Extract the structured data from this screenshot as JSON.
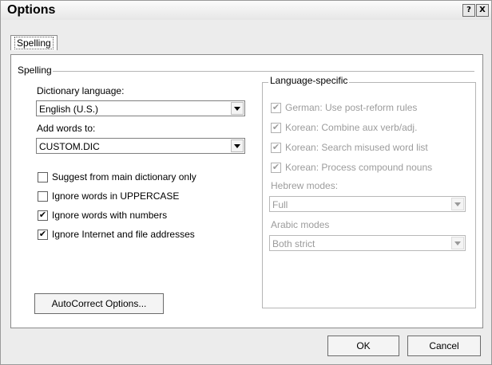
{
  "window": {
    "title": "Options",
    "help_glyph": "?",
    "close_glyph": "X"
  },
  "tabs": [
    {
      "label": "Spelling"
    }
  ],
  "spelling": {
    "section_label": "Spelling",
    "dictionary_language": {
      "label": "Dictionary language:",
      "value": "English (U.S.)"
    },
    "add_words_to": {
      "label": "Add words to:",
      "value": "CUSTOM.DIC"
    },
    "options": [
      {
        "label": "Suggest from main dictionary only",
        "checked": false
      },
      {
        "label": "Ignore words in UPPERCASE",
        "checked": false
      },
      {
        "label": "Ignore words with numbers",
        "checked": true
      },
      {
        "label": "Ignore Internet and file addresses",
        "checked": true
      }
    ],
    "autocorrect_button": "AutoCorrect Options..."
  },
  "language_specific": {
    "title": "Language-specific",
    "options": [
      {
        "label": "German: Use post-reform rules",
        "checked": true
      },
      {
        "label": "Korean: Combine aux verb/adj.",
        "checked": true
      },
      {
        "label": "Korean: Search misused word list",
        "checked": true
      },
      {
        "label": "Korean: Process compound nouns",
        "checked": true
      }
    ],
    "hebrew_modes": {
      "label": "Hebrew modes:",
      "value": "Full"
    },
    "arabic_modes": {
      "label": "Arabic modes",
      "value": "Both strict"
    }
  },
  "footer": {
    "ok": "OK",
    "cancel": "Cancel"
  },
  "icons": {
    "check_glyph": "✔"
  }
}
